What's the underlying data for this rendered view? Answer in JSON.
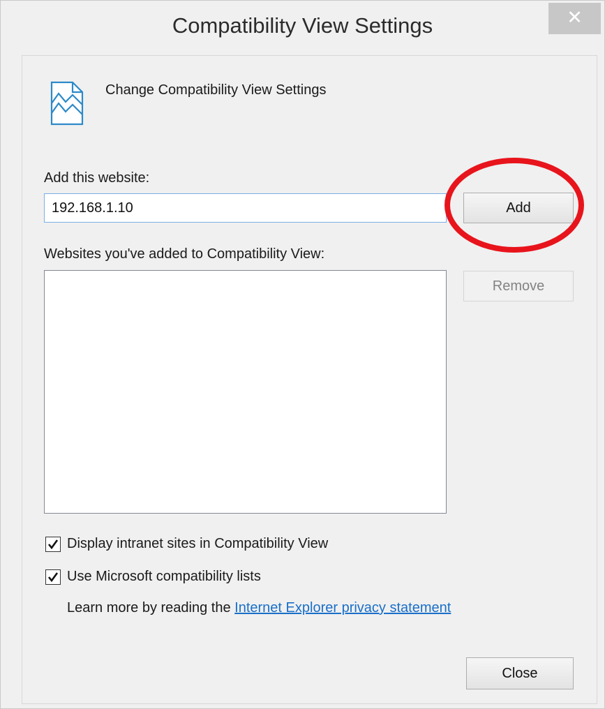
{
  "window": {
    "title": "Compatibility View Settings",
    "close_glyph": "✕",
    "close_icon": "close-icon"
  },
  "header": {
    "icon": "compatibility-view-icon",
    "text": "Change Compatibility View Settings"
  },
  "add_section": {
    "label": "Add this website:",
    "input_value": "192.168.1.10",
    "add_button_label": "Add"
  },
  "sites_section": {
    "label": "Websites you've added to Compatibility View:",
    "items": [],
    "remove_button_label": "Remove",
    "remove_enabled": false
  },
  "options": [
    {
      "label": "Display intranet sites in Compatibility View",
      "checked": true
    },
    {
      "label": "Use Microsoft compatibility lists",
      "checked": true
    }
  ],
  "learn_more": {
    "prefix": "Learn more by reading the ",
    "link_text": "Internet Explorer privacy statement"
  },
  "footer": {
    "close_button_label": "Close"
  },
  "annotation": {
    "shape": "ellipse",
    "color": "#e8141c",
    "target": "add-button"
  },
  "colors": {
    "link": "#1a6fc9",
    "input_border": "#7aaee6",
    "titlebar_close_bg": "#c7c7c7"
  }
}
